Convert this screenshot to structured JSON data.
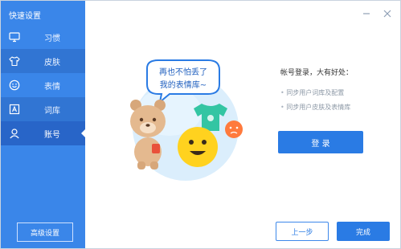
{
  "sidebar": {
    "title": "快速设置",
    "items": [
      {
        "label": "习惯",
        "icon": "monitor-icon"
      },
      {
        "label": "皮肤",
        "icon": "tshirt-icon"
      },
      {
        "label": "表情",
        "icon": "smiley-icon"
      },
      {
        "label": "词库",
        "icon": "dictionary-icon"
      },
      {
        "label": "账号",
        "icon": "user-icon"
      }
    ],
    "advanced_button": "高级设置",
    "accent": "#3a86e9"
  },
  "titlebar": {
    "icons": [
      "minimize-icon",
      "close-icon"
    ]
  },
  "illustration": {
    "bubble_line1": "再也不怕丢了",
    "bubble_line2": "我的表情库~"
  },
  "account": {
    "title": "帐号登录，大有好处：",
    "bullets": [
      "同步用户词库及配置",
      "同步用户皮肤及表情库"
    ],
    "login_button": "登 录"
  },
  "footer": {
    "prev_button": "上一步",
    "done_button": "完成"
  }
}
